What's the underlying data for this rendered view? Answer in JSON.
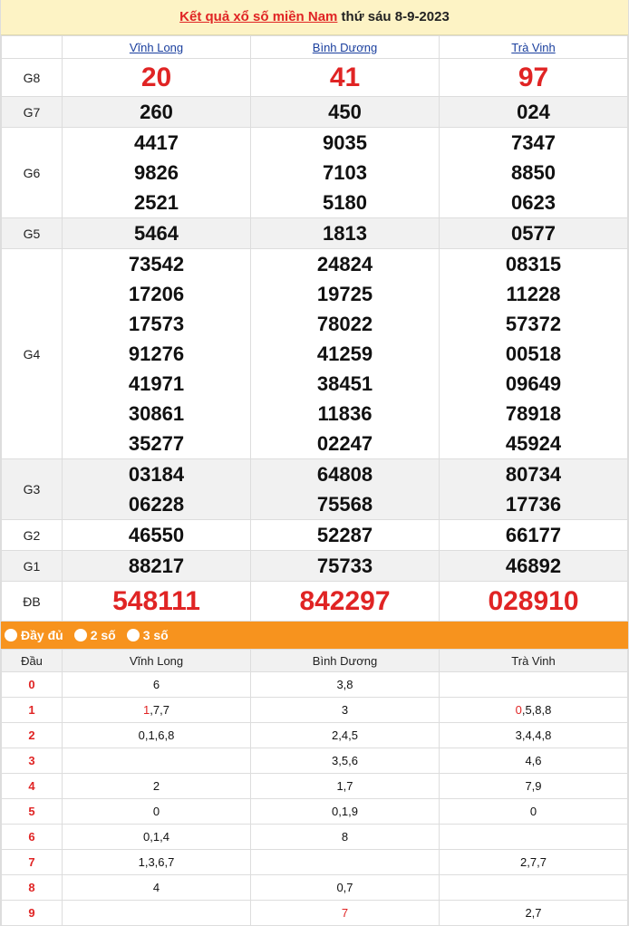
{
  "header": {
    "title_link": "Kết quả xổ số miền Nam",
    "title_rest": " thứ sáu 8-9-2023"
  },
  "provinces": [
    "Vĩnh Long",
    "Bình Dương",
    "Trà Vinh"
  ],
  "prizes": [
    {
      "label": "G8",
      "values": [
        [
          "20"
        ],
        [
          "41"
        ],
        [
          "97"
        ]
      ]
    },
    {
      "label": "G7",
      "values": [
        [
          "260"
        ],
        [
          "450"
        ],
        [
          "024"
        ]
      ]
    },
    {
      "label": "G6",
      "values": [
        [
          "4417",
          "9826",
          "2521"
        ],
        [
          "9035",
          "7103",
          "5180"
        ],
        [
          "7347",
          "8850",
          "0623"
        ]
      ]
    },
    {
      "label": "G5",
      "values": [
        [
          "5464"
        ],
        [
          "1813"
        ],
        [
          "0577"
        ]
      ]
    },
    {
      "label": "G4",
      "values": [
        [
          "73542",
          "17206",
          "17573",
          "91276",
          "41971",
          "30861",
          "35277"
        ],
        [
          "24824",
          "19725",
          "78022",
          "41259",
          "38451",
          "11836",
          "02247"
        ],
        [
          "08315",
          "11228",
          "57372",
          "00518",
          "09649",
          "78918",
          "45924"
        ]
      ]
    },
    {
      "label": "G3",
      "values": [
        [
          "03184",
          "06228"
        ],
        [
          "64808",
          "75568"
        ],
        [
          "80734",
          "17736"
        ]
      ]
    },
    {
      "label": "G2",
      "values": [
        [
          "46550"
        ],
        [
          "52287"
        ],
        [
          "66177"
        ]
      ]
    },
    {
      "label": "G1",
      "values": [
        [
          "88217"
        ],
        [
          "75733"
        ],
        [
          "46892"
        ]
      ]
    },
    {
      "label": "ĐB",
      "values": [
        [
          "548111"
        ],
        [
          "842297"
        ],
        [
          "028910"
        ]
      ]
    }
  ],
  "filter": {
    "options": [
      "Đầy đủ",
      "2 số",
      "3 số"
    ]
  },
  "loto": {
    "head_label": "Đầu",
    "columns": [
      "Vĩnh Long",
      "Bình Dương",
      "Trà Vinh"
    ],
    "rows": [
      {
        "dau": "0",
        "cells": [
          {
            "hl": "",
            "rest": "6"
          },
          {
            "hl": "",
            "rest": "3,8"
          },
          {
            "hl": "",
            "rest": ""
          }
        ]
      },
      {
        "dau": "1",
        "cells": [
          {
            "hl": "1",
            "rest": ",7,7"
          },
          {
            "hl": "",
            "rest": "3"
          },
          {
            "hl": "0",
            "rest": ",5,8,8"
          }
        ]
      },
      {
        "dau": "2",
        "cells": [
          {
            "hl": "",
            "rest": "0,1,6,8"
          },
          {
            "hl": "",
            "rest": "2,4,5"
          },
          {
            "hl": "",
            "rest": "3,4,4,8"
          }
        ]
      },
      {
        "dau": "3",
        "cells": [
          {
            "hl": "",
            "rest": ""
          },
          {
            "hl": "",
            "rest": "3,5,6"
          },
          {
            "hl": "",
            "rest": "4,6"
          }
        ]
      },
      {
        "dau": "4",
        "cells": [
          {
            "hl": "",
            "rest": "2"
          },
          {
            "hl": "",
            "rest": "1,7"
          },
          {
            "hl": "",
            "rest": "7,9"
          }
        ]
      },
      {
        "dau": "5",
        "cells": [
          {
            "hl": "",
            "rest": "0"
          },
          {
            "hl": "",
            "rest": "0,1,9"
          },
          {
            "hl": "",
            "rest": "0"
          }
        ]
      },
      {
        "dau": "6",
        "cells": [
          {
            "hl": "",
            "rest": "0,1,4"
          },
          {
            "hl": "",
            "rest": "8"
          },
          {
            "hl": "",
            "rest": ""
          }
        ]
      },
      {
        "dau": "7",
        "cells": [
          {
            "hl": "",
            "rest": "1,3,6,7"
          },
          {
            "hl": "",
            "rest": ""
          },
          {
            "hl": "",
            "rest": "2,7,7"
          }
        ]
      },
      {
        "dau": "8",
        "cells": [
          {
            "hl": "",
            "rest": "4"
          },
          {
            "hl": "",
            "rest": "0,7"
          },
          {
            "hl": "",
            "rest": ""
          }
        ]
      },
      {
        "dau": "9",
        "cells": [
          {
            "hl": "",
            "rest": ""
          },
          {
            "hl": "7",
            "rest": ""
          },
          {
            "hl": "",
            "rest": "2,7"
          }
        ]
      }
    ]
  }
}
